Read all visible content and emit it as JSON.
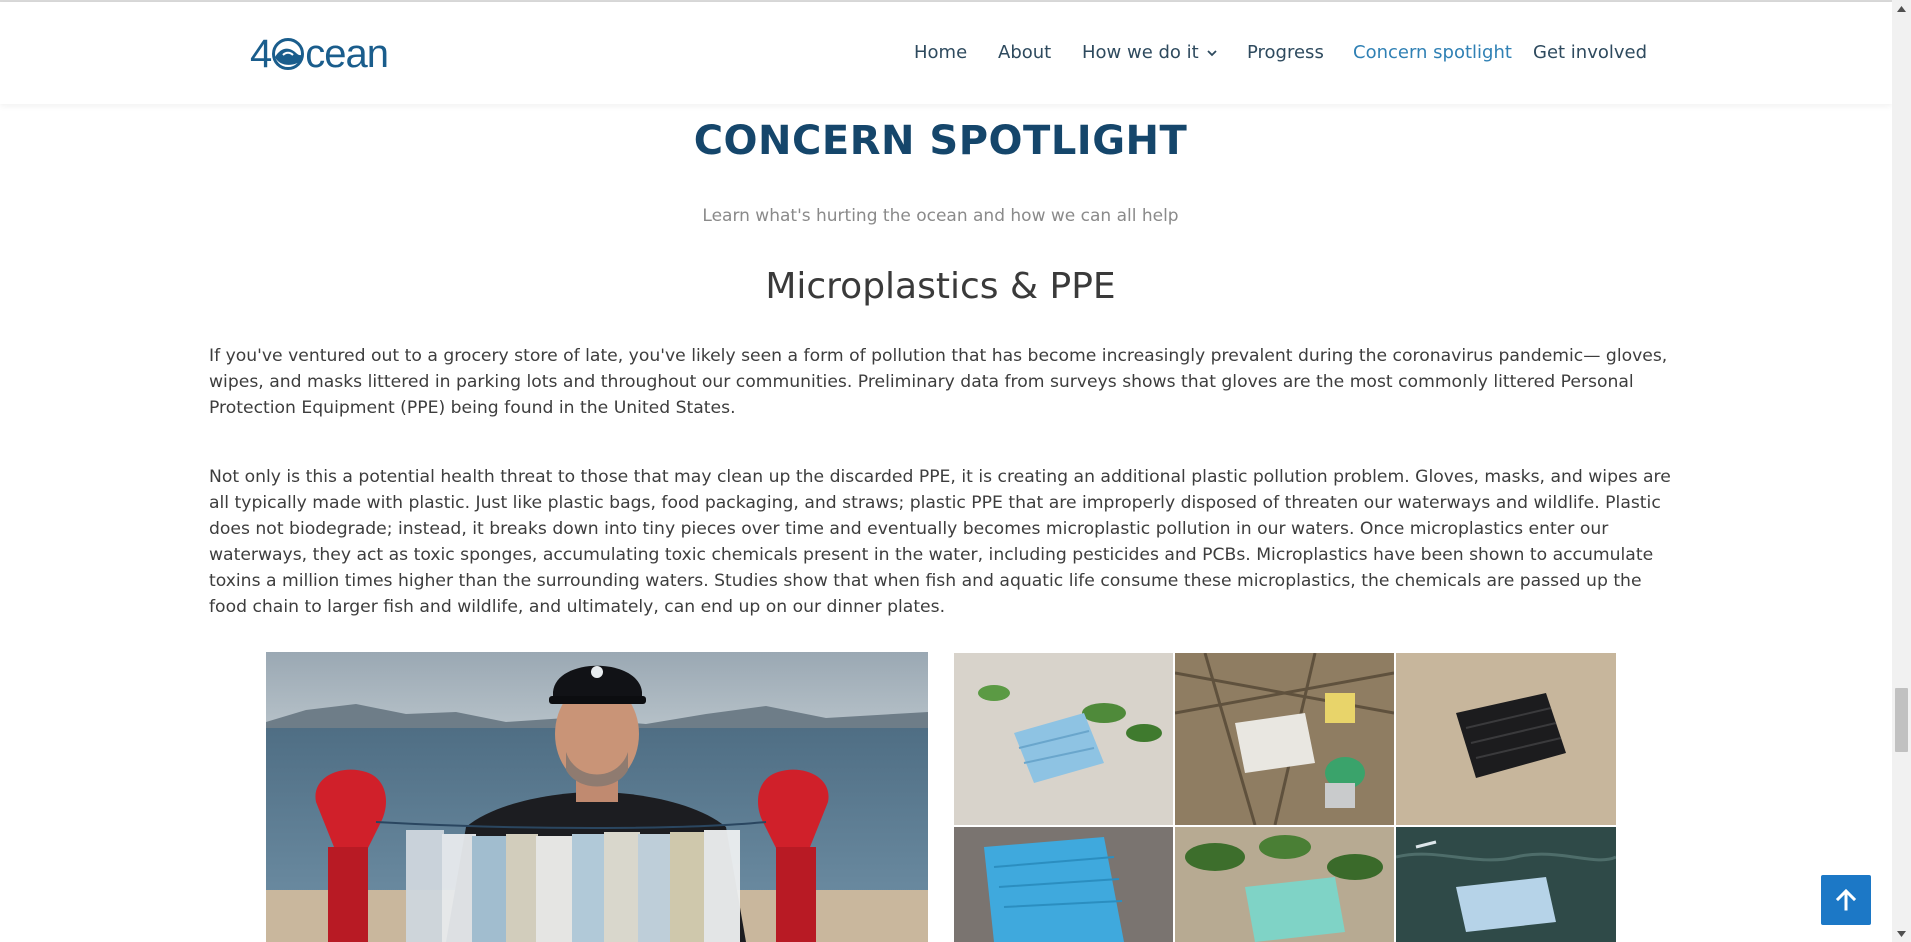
{
  "header": {
    "logo_text_prefix": "4",
    "logo_text_suffix": "cean",
    "nav": [
      {
        "label": "Home"
      },
      {
        "label": "About"
      },
      {
        "label": "How we do it"
      },
      {
        "label": "Progress"
      },
      {
        "label": "Concern spotlight"
      },
      {
        "label": "Get involved"
      }
    ],
    "active_nav": "Concern spotlight",
    "brand_color": "#1a5d8c",
    "active_color": "#2f80b4"
  },
  "main": {
    "title": "CONCERN SPOTLIGHT",
    "subtitle": "Learn what's hurting the ocean and how we can all help",
    "section_title": "Microplastics & PPE",
    "paragraphs": [
      "If you've ventured out to a grocery store of late, you've likely seen a form of pollution that has become increasingly prevalent during the coronavirus pandemic— gloves, wipes, and masks littered in parking lots and throughout our communities. Preliminary data from surveys shows that gloves are the most commonly littered Personal Protection Equipment (PPE) being found in the United States.",
      "Not only is this a potential health threat to those that may clean up the discarded PPE, it is creating an additional plastic pollution problem. Gloves, masks, and wipes are all typically made with plastic. Just like plastic bags, food packaging, and straws; plastic PPE that are improperly disposed of threaten our waterways and wildlife. Plastic does not biodegrade; instead, it breaks down into tiny pieces over time and eventually becomes microplastic pollution in our waters. Once microplastics enter our waterways, they act as toxic sponges, accumulating toxic chemicals present in the water, including pesticides and PCBs. Microplastics have been shown to accumulate toxins a million times higher than the surrounding waters. Studies show that when fish and aquatic life consume these microplastics, the chemicals are passed up the food chain to larger fish and wildlife, and ultimately, can end up on our dinner plates."
    ],
    "images": {
      "main_photo": "man-holding-collected-masks-photo",
      "grid": [
        "mask-on-sand-with-leaves",
        "mask-in-beach-debris",
        "black-mask-on-sand",
        "blue-mask-in-debris",
        "mask-under-plants",
        "mask-floating-in-water"
      ]
    }
  },
  "ui": {
    "back_to_top_icon": "arrow-up-icon",
    "button_color": "#1c78c6"
  }
}
